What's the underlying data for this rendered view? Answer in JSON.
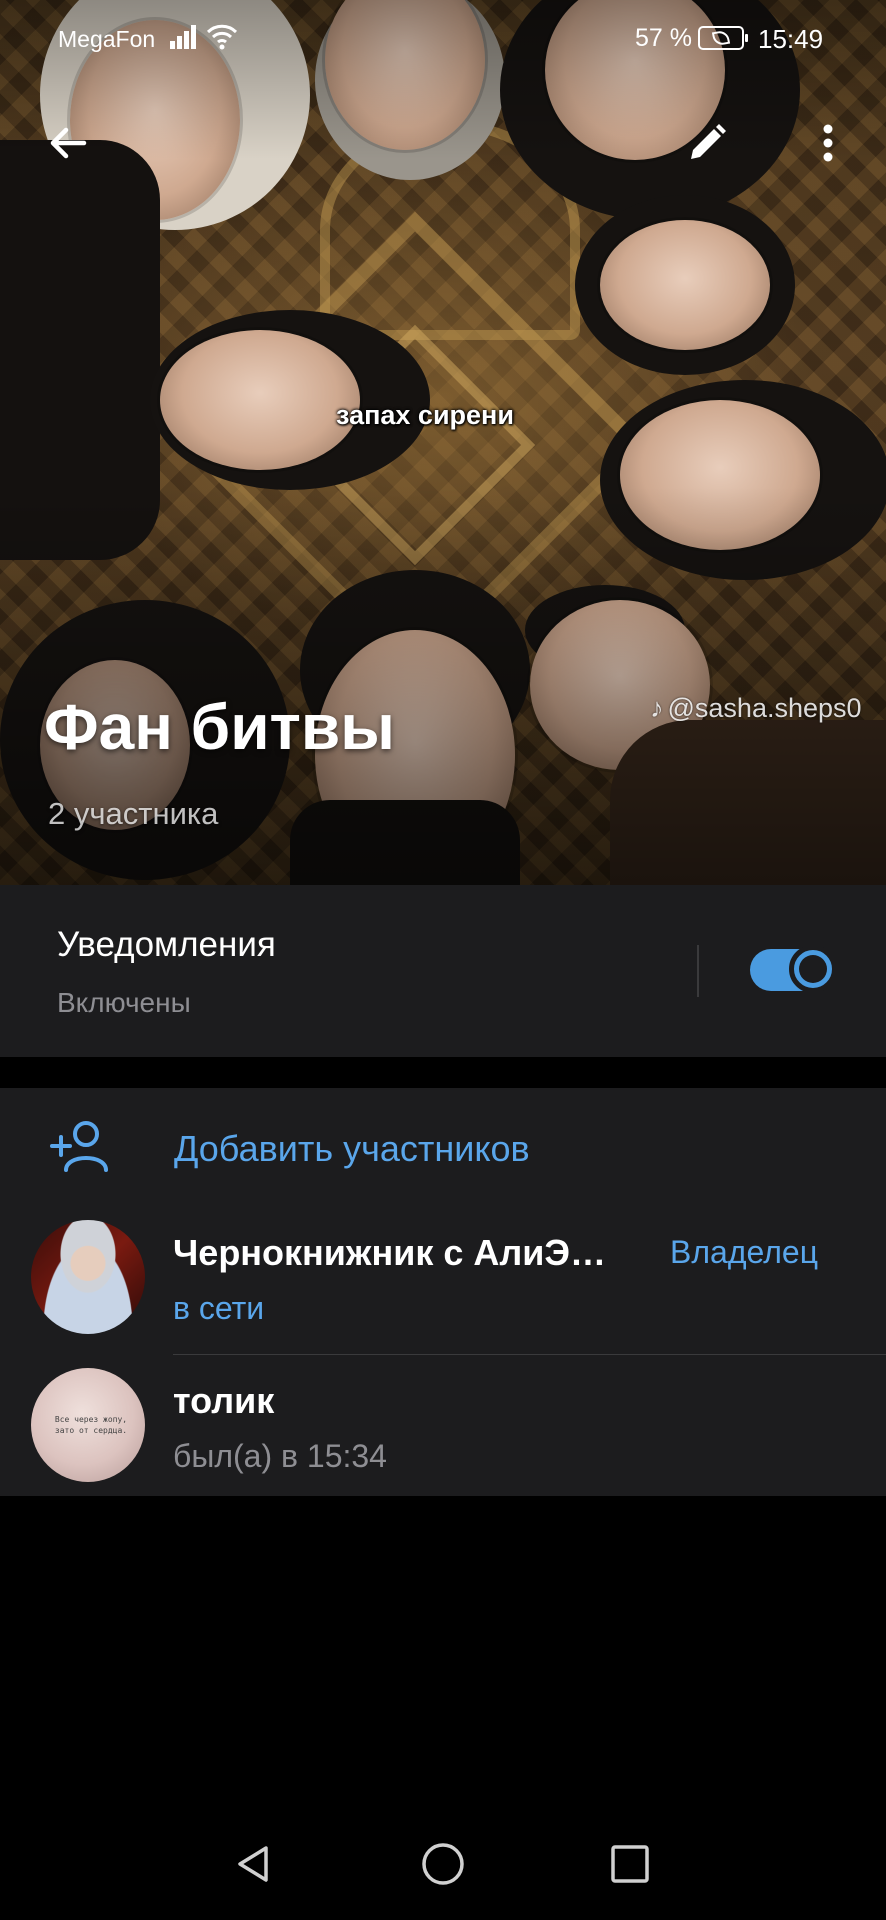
{
  "status_bar": {
    "carrier": "MegaFon",
    "battery_percent": "57 %",
    "time": "15:49"
  },
  "header": {
    "photo_caption": "запах сирени",
    "watermark": "@sasha.sheps0",
    "watermark_logo": "♪",
    "title": "Фан битвы",
    "subtitle": "2 участника"
  },
  "toolbar": {
    "back_icon": "arrow-left-icon",
    "edit_icon": "pencil-icon",
    "more_icon": "more-vert-icon"
  },
  "notifications": {
    "title": "Уведомления",
    "status": "Включены",
    "enabled": true,
    "accent_color": "#4a9be0"
  },
  "members": {
    "add_label": "Добавить участников",
    "add_icon": "person-add-icon",
    "list": [
      {
        "name": "Чернокнижник с АлиЭ…",
        "status": "в сети",
        "role": "Владелец"
      },
      {
        "name": "толик",
        "status": "был(а) в 15:34",
        "avatar_note": "Все через жопу,\nзато от сердца."
      }
    ]
  },
  "nav": {
    "back_icon": "triangle-back-icon",
    "home_icon": "circle-home-icon",
    "recent_icon": "square-recent-icon"
  }
}
